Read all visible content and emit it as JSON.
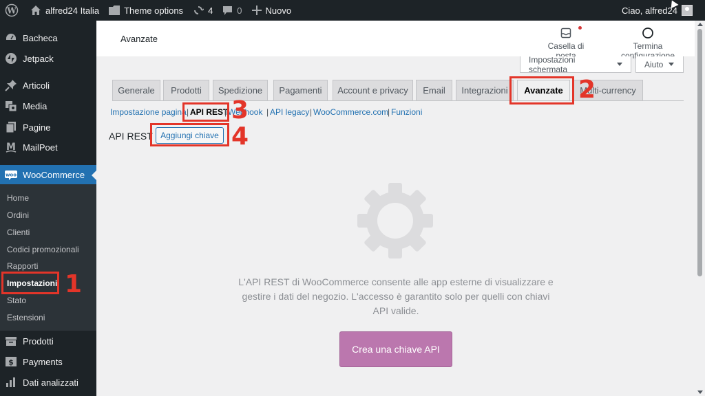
{
  "adminbar": {
    "site_name": "alfred24 Italia",
    "theme_options": "Theme options",
    "updates_count": "4",
    "comments_count": "0",
    "new_label": "Nuovo",
    "greeting": "Ciao, alfred24"
  },
  "sidebar": {
    "items": [
      {
        "label": "Bacheca",
        "icon": "dashboard-icon"
      },
      {
        "label": "Jetpack",
        "icon": "jetpack-icon"
      },
      {
        "label": "Articoli",
        "icon": "pin-icon"
      },
      {
        "label": "Media",
        "icon": "media-icon"
      },
      {
        "label": "Pagine",
        "icon": "page-icon"
      },
      {
        "label": "MailPoet",
        "icon": "mailpoet-icon"
      },
      {
        "label": "WooCommerce",
        "icon": "woo-icon"
      }
    ],
    "submenu": [
      "Home",
      "Ordini",
      "Clienti",
      "Codici promozionali",
      "Rapporti",
      "Impostazioni",
      "Stato",
      "Estensioni"
    ],
    "bottom_items": [
      {
        "label": "Prodotti",
        "icon": "archive-icon"
      },
      {
        "label": "Payments",
        "icon": "dollar-icon"
      },
      {
        "label": "Dati analizzati",
        "icon": "chart-icon"
      }
    ]
  },
  "header": {
    "title": "Avanzate",
    "inbox": "Casella di posta",
    "finish_setup": "Termina configurazione"
  },
  "screen_options": {
    "screen": "Impostazioni schermata",
    "help": "Aiuto"
  },
  "tabs": [
    "Generale",
    "Prodotti",
    "Spedizione",
    "Pagamenti",
    "Account e privacy",
    "Email",
    "Integrazioni",
    "Avanzate",
    "Multi-currency"
  ],
  "subsubsub": {
    "links": [
      "Impostazione pagina",
      "API REST",
      "Webhook",
      "API legacy",
      "WooCommerce.com",
      "Funzioni"
    ],
    "separator": "|"
  },
  "section": {
    "title": "API REST",
    "add_key": "Aggiungi chiave"
  },
  "empty_state": {
    "description": "L'API REST di WooCommerce consente alle app esterne di visualizzare e gestire i dati del negozio. L'accesso è garantito solo per quelli con chiavi API valide.",
    "cta": "Crea una chiave API"
  },
  "annotations": [
    "1",
    "2",
    "3",
    "4"
  ],
  "colors": {
    "admin_dark": "#1d2327",
    "wp_blue": "#2271b1",
    "woo_purple": "#bb77ae",
    "annotation_red": "#e33529"
  }
}
